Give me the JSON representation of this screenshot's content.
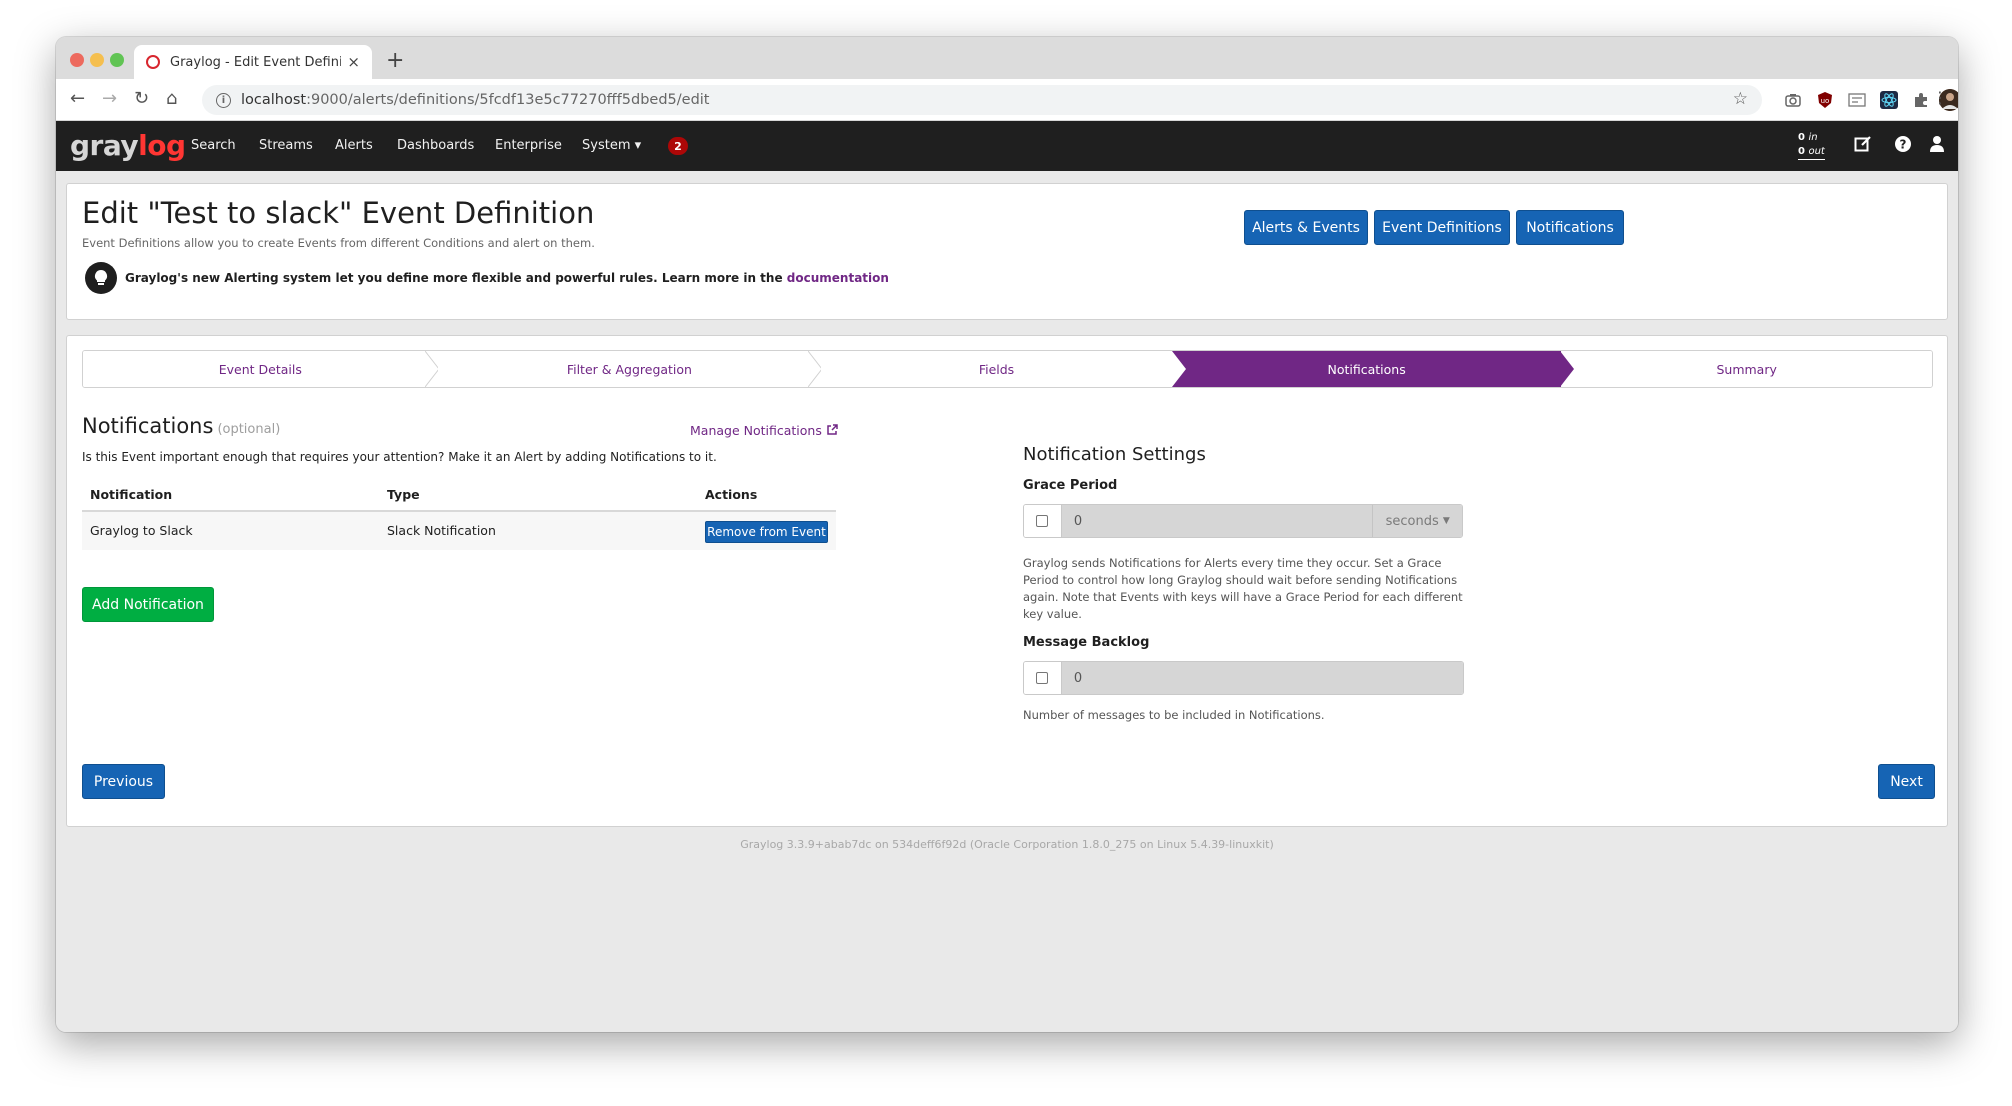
{
  "browser": {
    "tab_title": "Graylog - Edit Event Definition",
    "tab_close": "×",
    "new_tab": "+",
    "url_host": "localhost",
    "url_rest": ":9000/alerts/definitions/5fcdf13e5c77270fff5dbed5/edit",
    "icons": [
      "back-icon",
      "forward-icon",
      "reload-icon",
      "home-icon",
      "info-icon",
      "star-icon",
      "camera-icon",
      "ublock-icon",
      "extension-icon",
      "react-icon",
      "puzzle-icon",
      "profile-avatar",
      "menu-icon"
    ]
  },
  "navbar": {
    "logo_gray": "gray",
    "logo_log": "log",
    "items": [
      "Search",
      "Streams",
      "Alerts",
      "Dashboards",
      "Enterprise",
      "System"
    ],
    "system_caret": "▾",
    "notification_count": "2",
    "throughput_in_value": "0",
    "throughput_in_label": "in",
    "throughput_out_value": "0",
    "throughput_out_label": "out"
  },
  "header": {
    "title": "Edit \"Test to slack\" Event Definition",
    "description": "Event Definitions allow you to create Events from different Conditions and alert on them.",
    "tip": "Graylog's new Alerting system let you define more flexible and powerful rules. Learn more in the",
    "tip_link": "documentation",
    "buttons": [
      "Alerts & Events",
      "Event Definitions",
      "Notifications"
    ]
  },
  "wizard": {
    "steps": [
      "Event Details",
      "Filter & Aggregation",
      "Fields",
      "Notifications",
      "Summary"
    ],
    "active_step": "Notifications"
  },
  "notifications": {
    "title": "Notifications",
    "optional": "(optional)",
    "manage_link": "Manage Notifications",
    "description": "Is this Event important enough that requires your attention? Make it an Alert by adding Notifications to it.",
    "columns": [
      "Notification",
      "Type",
      "Actions"
    ],
    "rows": [
      {
        "name": "Graylog to Slack",
        "type": "Slack Notification",
        "action": "Remove from Event"
      }
    ],
    "add_button": "Add Notification"
  },
  "settings": {
    "title": "Notification Settings",
    "grace_label": "Grace Period",
    "grace_value": "0",
    "grace_unit": "seconds",
    "grace_help": "Graylog sends Notifications for Alerts every time they occur. Set a Grace Period to control how long Graylog should wait before sending Notifications again. Note that Events with keys will have a Grace Period for each different key value.",
    "backlog_label": "Message Backlog",
    "backlog_value": "0",
    "backlog_help": "Number of messages to be included in Notifications."
  },
  "actions": {
    "previous": "Previous",
    "next": "Next"
  },
  "footer": "Graylog 3.3.9+abab7dc on 534deff6f92d (Oracle Corporation 1.8.0_275 on Linux 5.4.39-linuxkit)",
  "colors": {
    "primary": "#1664b4",
    "accent_purple": "#702785",
    "success": "#00ae42",
    "navbar": "#1f1f1f",
    "badge": "#ad0707"
  }
}
